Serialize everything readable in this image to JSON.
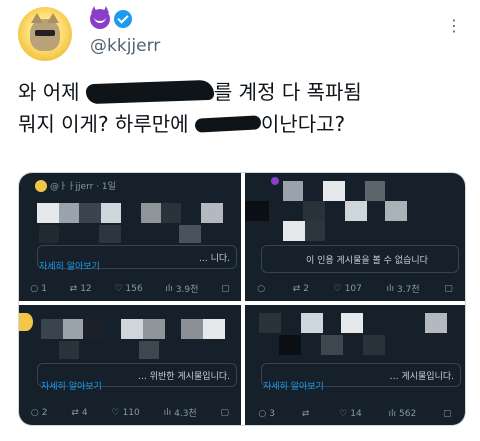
{
  "author": {
    "handle": "@kkjjerr",
    "avatar_icon": "cat-with-sunglasses-avatar",
    "badge_icon": "devil-emoji-icon",
    "verified_icon": "verified-badge-icon"
  },
  "tweet": {
    "line1_a": "와 어제 ",
    "line1_b": "를 계정 다 폭파됨",
    "line2_a": "뭐지 이게? 하루만에 ",
    "line2_b": "이난다고?"
  },
  "shots": [
    {
      "header_name": "@ㅏㅏjjerr · 1일",
      "notice": "... 니다.",
      "link": "자세히 알아보기",
      "actions": {
        "reply": "1",
        "retweet": "12",
        "like": "156",
        "views": "3.9천"
      }
    },
    {
      "notice": "이 인용 게시물을 볼 수 없습니다",
      "actions": {
        "reply": "",
        "retweet": "2",
        "like": "107",
        "views": "3.7천"
      }
    },
    {
      "notice": "… 위반한 게시물입니다.",
      "link": "자세히 알아보기",
      "actions": {
        "reply": "2",
        "retweet": "4",
        "like": "110",
        "views": "4.3천"
      }
    },
    {
      "notice": "… 게시물입니다.",
      "link": "자세히 알아보기",
      "actions": {
        "reply": "3",
        "retweet": "",
        "like": "14",
        "views": "562"
      }
    }
  ],
  "colors": {
    "accent": "#1d9bf0",
    "dark_bg": "#15202b",
    "text": "#0f1419",
    "muted": "#536471"
  }
}
